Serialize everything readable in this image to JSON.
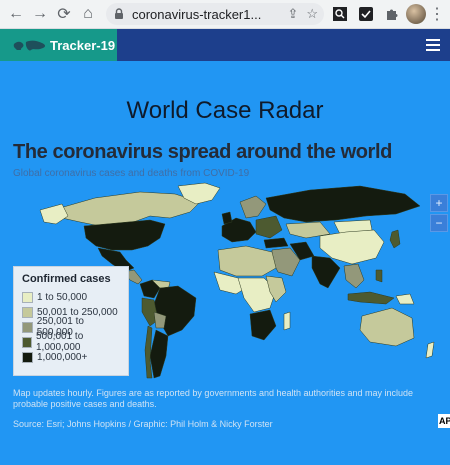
{
  "browser": {
    "url": "coronavirus-tracker1...",
    "nav_icons": [
      "back-icon",
      "forward-icon",
      "reload-icon",
      "home-icon"
    ]
  },
  "header": {
    "brand": "Tracker-19",
    "menu_icon": "hamburger-menu-icon"
  },
  "page": {
    "title": "World Case Radar"
  },
  "map": {
    "headline": "The coronavirus spread around the world",
    "subheadline": "Global coronavirus cases and deaths from COVID-19",
    "zoom_in": "+",
    "zoom_out": "−"
  },
  "legend": {
    "title": "Confirmed cases",
    "items": [
      {
        "label": "1 to 50,000",
        "color": "#e8eec4"
      },
      {
        "label": "50,001 to 250,000",
        "color": "#c5c99b"
      },
      {
        "label": "250,001 to 500,000",
        "color": "#93987a"
      },
      {
        "label": "500,001 to 1,000,000",
        "color": "#4d5a30"
      },
      {
        "label": "1,000,000+",
        "color": "#141b0f"
      }
    ]
  },
  "footer": {
    "note": "Map updates hourly. Figures are as reported by governments and health authorities and may include probable positive cases and deaths.",
    "source": "Source: Esri; Johns Hopkins / Graphic: Phil Holm & Nicky Forster",
    "badge": "AP"
  },
  "colors": {
    "ocean": "#2196f3",
    "header": "#1d3f8c",
    "brand": "#16998a"
  }
}
